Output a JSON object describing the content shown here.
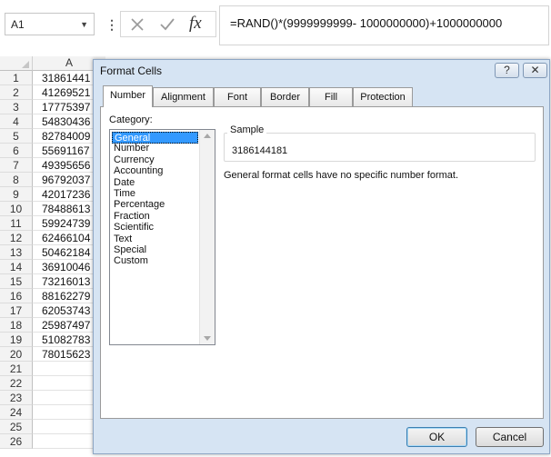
{
  "namebox": {
    "value": "A1"
  },
  "formula_bar": {
    "separator": "⋮",
    "cancel_icon": "close-icon",
    "enter_icon": "checkmark-icon",
    "fx_label": "fx",
    "formula": "=RAND()*(9999999999- 1000000000)+1000000000"
  },
  "sheet": {
    "column_header": "A",
    "rows": [
      {
        "num": "1",
        "value": "31861441"
      },
      {
        "num": "2",
        "value": "41269521"
      },
      {
        "num": "3",
        "value": "17775397"
      },
      {
        "num": "4",
        "value": "54830436"
      },
      {
        "num": "5",
        "value": "82784009"
      },
      {
        "num": "6",
        "value": "55691167"
      },
      {
        "num": "7",
        "value": "49395656"
      },
      {
        "num": "8",
        "value": "96792037"
      },
      {
        "num": "9",
        "value": "42017236"
      },
      {
        "num": "10",
        "value": "78488613"
      },
      {
        "num": "11",
        "value": "59924739"
      },
      {
        "num": "12",
        "value": "62466104"
      },
      {
        "num": "13",
        "value": "50462184"
      },
      {
        "num": "14",
        "value": "36910046"
      },
      {
        "num": "15",
        "value": "73216013"
      },
      {
        "num": "16",
        "value": "88162279"
      },
      {
        "num": "17",
        "value": "62053743"
      },
      {
        "num": "18",
        "value": "25987497"
      },
      {
        "num": "19",
        "value": "51082783"
      },
      {
        "num": "20",
        "value": "78015623"
      },
      {
        "num": "21",
        "value": ""
      },
      {
        "num": "22",
        "value": ""
      },
      {
        "num": "23",
        "value": ""
      },
      {
        "num": "24",
        "value": ""
      },
      {
        "num": "25",
        "value": ""
      },
      {
        "num": "26",
        "value": ""
      }
    ]
  },
  "dialog": {
    "title": "Format Cells",
    "help_label": "?",
    "close_label": "✕",
    "tabs": [
      "Number",
      "Alignment",
      "Font",
      "Border",
      "Fill",
      "Protection"
    ],
    "active_tab": "Number",
    "category_label": "Category:",
    "categories": [
      "General",
      "Number",
      "Currency",
      "Accounting",
      "Date",
      "Time",
      "Percentage",
      "Fraction",
      "Scientific",
      "Text",
      "Special",
      "Custom"
    ],
    "selected_category": "General",
    "sample_label": "Sample",
    "sample_value": "3186144181",
    "description": "General format cells have no specific number format.",
    "ok_label": "OK",
    "cancel_label": "Cancel"
  },
  "colors": {
    "selection": "#3399ff",
    "dialog_frame": "#d6e4f3"
  }
}
